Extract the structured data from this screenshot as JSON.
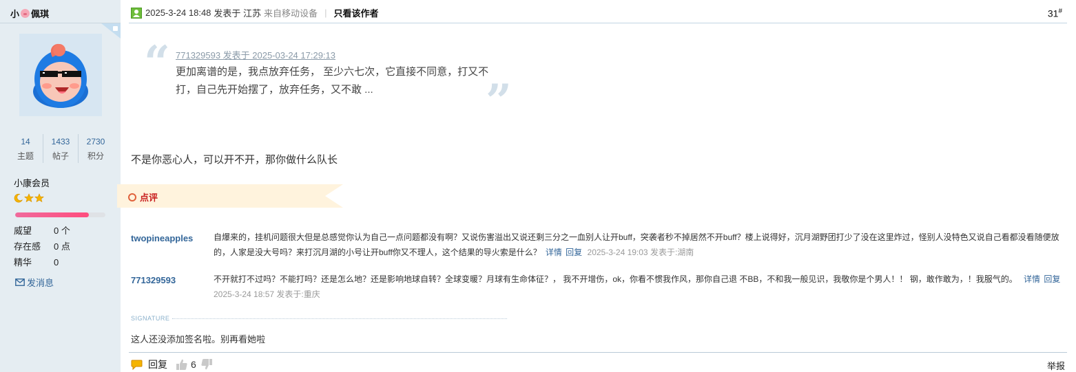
{
  "user": {
    "name_part1": "小",
    "name_part2": "佩琪",
    "stats": [
      {
        "value": "14",
        "label": "主题"
      },
      {
        "value": "1433",
        "label": "帖子"
      },
      {
        "value": "2730",
        "label": "积分"
      }
    ],
    "grade": "小康会员",
    "level_progress": 0.82,
    "props": [
      {
        "key": "威望",
        "value": "0 个"
      },
      {
        "key": "存在感",
        "value": "0 点"
      },
      {
        "key": "精华",
        "value": "0"
      }
    ],
    "send_message": "发消息"
  },
  "post": {
    "datetime": "2025-3-24 18:48",
    "posted_in": "发表于 江苏",
    "device": "来自移动设备",
    "separator": "|",
    "only_author": "只看该作者",
    "floor": "31",
    "floor_mark": "#",
    "quote": {
      "meta": "771329593 发表于 2025-03-24 17:29:13",
      "text": "更加离谱的是，我点放弃任务， 至少六七次，它直接不同意，打又不打，自己先开始摆了，放弃任务，又不敢 ..."
    },
    "body": "不是你恶心人，可以开不开，那你做什么队长",
    "dianping_label": "点评",
    "comments": [
      {
        "author": "twopineapples",
        "text": "自爆来的，挂机问题很大但是总感觉你认为自己一点问题都没有啊？又说伤害溢出又说还剩三分之一血别人让开buff，突袭者秒不掉居然不开buff？楼上说得好，沉月湖野团打少了没在这里炸过，怪别人没特色又说自己看都没看随便放的，人家是没大号吗？来打沉月湖的小号让开buff你又不理人，这个结果的导火索是什么？",
        "detail": "详情",
        "reply": "回复",
        "meta": "2025-3-24 19:03 发表于:湖南"
      },
      {
        "author": "771329593",
        "text": "不开就打不过吗？不能打吗？还是怎么地？还是影响地球自转？全球变暖？月球有生命体征？， 我不开增伤，ok，你看不惯我作风，那你自己退 不BB，不和我一般见识，我敬你是个男人！！ 钢，敢作敢为，！我服气的。",
        "detail": "详情",
        "reply": "回复",
        "meta": "2025-3-24 18:57 发表于:重庆"
      }
    ],
    "signature_label": "SIGNATURE",
    "signature": "这人还没添加签名啦。别再看她啦",
    "reply_label": "回复",
    "like_count": "6",
    "report_label": "举报"
  },
  "colors": {
    "sidebar_bg": "#e5edf2",
    "link_blue": "#336699",
    "dianping_bg": "#fff3dd",
    "dianping_red": "#c81e1e",
    "star_gold": "#f5b400"
  },
  "icons": [
    "pig-icon",
    "corner-badge-icon",
    "avatar-icon",
    "moon-icon",
    "star-icon",
    "mail-icon",
    "user-icon",
    "quote-open-icon",
    "quote-close-icon",
    "comment-icon",
    "thumb-up-icon",
    "thumb-down-icon"
  ]
}
